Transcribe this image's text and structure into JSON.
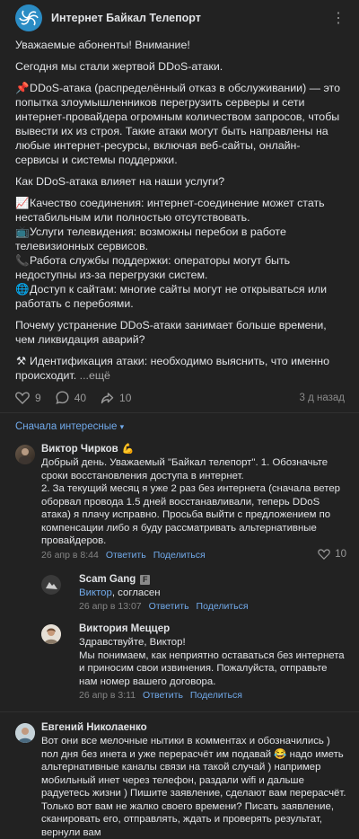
{
  "post": {
    "group_name": "Интернет Байкал Телепорт",
    "greeting": "Уважаемые абоненты! Внимание!",
    "intro": "Сегодня мы стали жертвой DDoS-атаки.",
    "definition": "DDoS-атака (распределённый отказ в обслуживании) — это попытка злоумышленников перегрузить серверы и сети интернет-провайдера огромным количеством запросов, чтобы вывести их из строя. Такие атаки могут быть направлены на любые интернет-ресурсы, включая веб-сайты, онлайн-сервисы и системы поддержки.",
    "question": "Как DDoS-атака влияет на наши услуги?",
    "impacts": [
      {
        "icon": "chart-icon",
        "glyph": "📈",
        "text": "Качество соединения: интернет-соединение может стать нестабильным или полностью отсутствовать."
      },
      {
        "icon": "tv-icon",
        "glyph": "📺",
        "text": "Услуги телевидения: возможны перебои в работе телевизионных сервисов."
      },
      {
        "icon": "phone-icon",
        "glyph": "📞",
        "text": "Работа службы поддержки: операторы могут быть недоступны из-за перегрузки систем."
      },
      {
        "icon": "globe-icon",
        "glyph": "🌐",
        "text": "Доступ к сайтам: многие сайты могут не открываться или работать с перебоями."
      }
    ],
    "why": "Почему устранение DDoS-атаки занимает больше времени, чем ликвидация аварий?",
    "step": {
      "icon": "tools-icon",
      "glyph": "⚒",
      "text": "Идентификация атаки: необходимо выяснить, что именно происходит."
    },
    "show_more": "...ещё",
    "likes": "9",
    "comments": "40",
    "reposts": "10",
    "time": "3 д назад"
  },
  "sort_label": "Сначала интересные",
  "comments": [
    {
      "author": "Виктор Чирков",
      "author_emoji": "💪",
      "text": "Добрый день. Уважаемый \"Байкал телепорт\". 1. Обозначьте сроки восстановления доступа в интернет.\n2. За текущий месяц я уже 2 раз без интернета (сначала ветер оборвал провода 1.5 дней восстанавливали, теперь DDoS атака) я плачу исправно. Просьба выйти с предложением по компенсации либо я буду рассматривать альтернативные провайдеров.",
      "time": "26 апр в 8:44",
      "reply_label": "Ответить",
      "share_label": "Поделиться",
      "likes": "10"
    }
  ],
  "replies": [
    {
      "author": "Scam Gang",
      "badge": "F",
      "mention": "Виктор",
      "text": ", согласен",
      "time": "26 апр в 13:07",
      "reply_label": "Ответить",
      "share_label": "Поделиться"
    },
    {
      "author": "Виктория Меццер",
      "text": "Здравствуйте, Виктор!\nМы понимаем, как неприятно оставаться без интернета и приносим свои извинения. Пожалуйста, отправьте нам номер вашего договора.",
      "time": "26 апр в 3:11",
      "reply_label": "Ответить",
      "share_label": "Поделиться"
    }
  ],
  "comment2": {
    "author": "Евгений Николаенко",
    "text": "Вот они все мелочные нытики в комментах и обозначились ) пол дня без инета и уже перерасчёт им подавай 😂 надо иметь альтернативные каналы связи на такой случай ) например мобильный инет через телефон, раздали wifi и дальше радуетесь жизни ) Пишите заявление, сделают вам перерасчёт. Только вот вам не жалко своего времени? Писать заявление, сканировать его, отправлять, ждать и проверять результат, вернули вам"
  },
  "colors": {
    "accent": "#71aaeb",
    "background": "#141414",
    "card": "#222222"
  }
}
